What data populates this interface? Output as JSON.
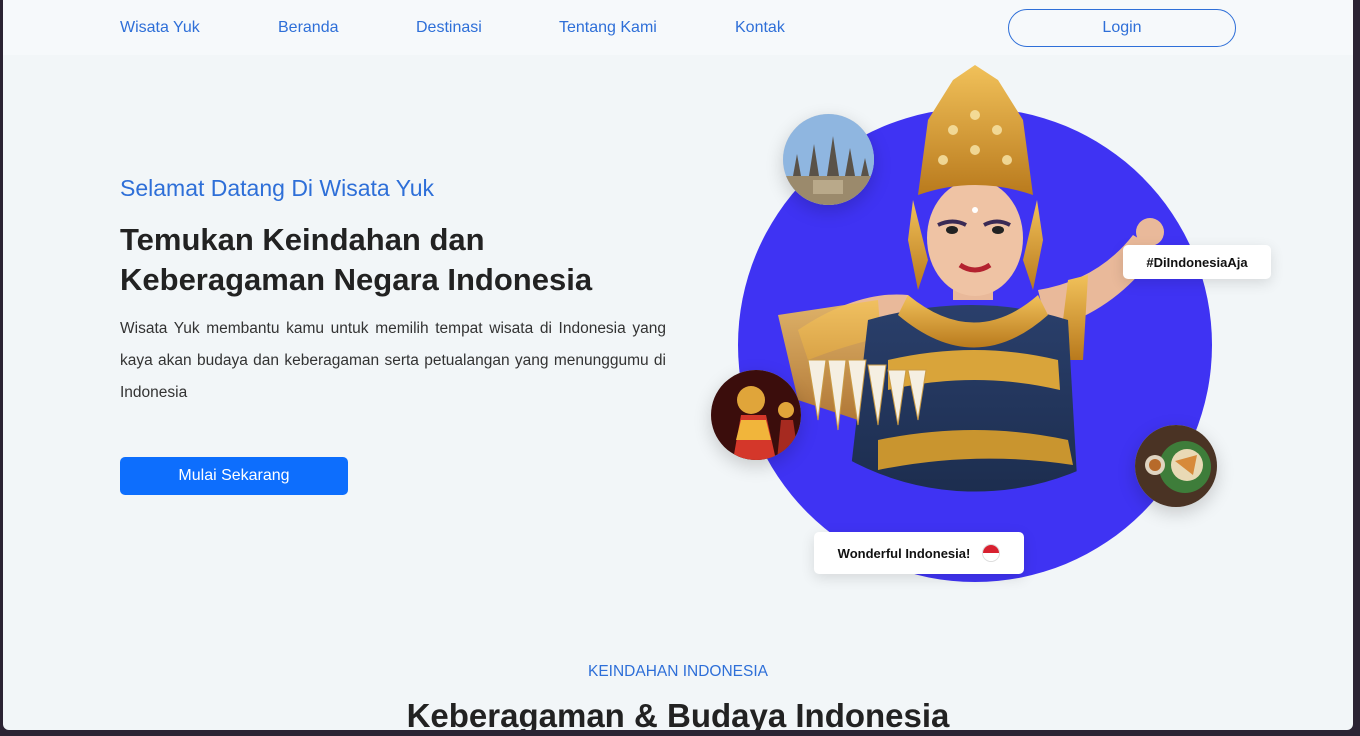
{
  "nav": {
    "brand": "Wisata Yuk",
    "items": [
      "Beranda",
      "Destinasi",
      "Tentang Kami",
      "Kontak"
    ],
    "login_label": "Login"
  },
  "hero": {
    "subtitle": "Selamat Datang Di Wisata Yuk",
    "title_line1": "Temukan Keindahan dan",
    "title_line2": "Keberagaman Negara Indonesia",
    "description": "Wisata Yuk membantu kamu untuk memilih tempat wisata di Indonesia yang kaya akan budaya dan keberagaman serta petualangan yang menunggumu di Indonesia",
    "cta_label": "Mulai Sekarang"
  },
  "badges": {
    "hashtag": "#DiIndonesiaAja",
    "wonderful": "Wonderful Indonesia!"
  },
  "colors": {
    "accent": "#2e6fd8",
    "button": "#0d6efd",
    "circle": "#3f33f3",
    "background": "#f2f6f8"
  },
  "section": {
    "label": "KEINDAHAN INDONESIA",
    "title": "Keberagaman & Budaya Indonesia"
  }
}
